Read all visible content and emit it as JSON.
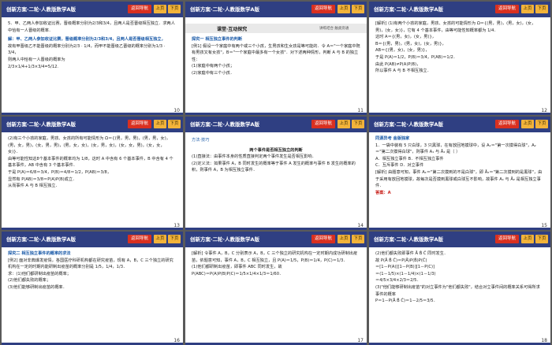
{
  "header": {
    "title": "创新方案·二轮·人教版数学A版",
    "btn_back": "返回导航",
    "btn_up": "上页",
    "btn_down": "下页"
  },
  "slides": [
    {
      "page": "10",
      "lines": [
        "5．甲、乙两人参加收证比赛，晋级概率分别为2/3和3/4，且两人是否晋级相互独立．求两人中恰有一人晋级的概率．",
        "解：甲、乙两人参加收证比赛，晋级概率分别为2/3和3/4，且两人是否晋级相互独立，",
        "故有甲晋级乙不能晋级的概率分别为2/3 · 1/4，而甲不能晋级乙晋级的概率分别为1/3 · 3/4，",
        "则两人中恰有一人晋级的概率为",
        "2/3×1/4+1/3×3/4=5/12."
      ]
    },
    {
      "page": "11",
      "band_title": "课堂·互动探究",
      "band_sub": "讲练结合  触类旁通",
      "lines": [
        "探究一    相互独立事件的判断",
        "[例1]  假设一个家庭中有两个或三个小孩，生男孩和生女孩是等可能的．令 A＝\"一个家庭中既有男孩又有女孩\"，B＝\"一个家庭中最多有一个女孩\"．对下述两种情形，判断 A 与 B 的独立性：",
        "(1)家庭中有两个小孩；",
        "(2)家庭中有三个小孩．"
      ]
    },
    {
      "page": "12",
      "lines": [
        "[解析]  (1)有两个小孩的家庭，男孩、女孩的可能情形为 Ω＝{(男，男)，(男，女)，(女，男)，(女，女)}，它有 4 个基本事件，由等可能性知概率都为 1/4．",
        "这时 A＝{(男，女)，(女，男)}，",
        "B＝{(男，男)，(男，女)，(女，男)}，",
        "AB＝{(男，女)，(女，男)}，",
        "于是 P(A)＝1/2，P(B)＝3/4，P(AB)＝1/2．",
        "由此 P(AB)≠P(A)P(B)，",
        "所以事件 A 与 B 不相互独立．"
      ]
    },
    {
      "page": "13",
      "lines": [
        "(2)有三个小孩的家庭，男孩、女孩的所有可能情形为 Ω＝{(男，男，男)，(男，男，女)，(男，女，男)，(女，男，男)，(男，女，女)，(女，男，女)，(女，女，男)，(女，女，女)}．",
        "由等可能性知这8个基本事件的概率均为 1/8，这时 A 中含有 6 个基本事件，B 中含有 4 个基本事件，AB 中含有 3 个基本事件．",
        "于是 P(A)＝6/8＝3/4，P(B)＝4/8＝1/2，P(AB)＝3/8，",
        "显然有 P(AB)＝3/8＝P(A)P(B)成立．",
        "从而事件 A 与 B 相互独立．"
      ]
    },
    {
      "page": "14",
      "lines": [
        "方法·技巧",
        "两个事件是否相互独立的判断",
        "(1)直接法：由事件本身的性质直接判定两个事件发生是否相互影响．",
        "(2)定义法：如果事件 A，B 同时发生的概率等于事件 A 发生的概率与事件 B 发生的概率的积，则事件 A，B 为相互独立事件．"
      ]
    },
    {
      "page": "15",
      "lines": [
        "同源异考  金版独家",
        "1．一袋中装有 5 只白球，3 只黑球，在有放回地摸球中，设 A₁＝\"第一次摸得白球\"，A₂＝\"第二次摸得白球\"，则事件 A₁ 与 Ā₂ 是（    ）",
        "A．相互独立事件          B．不相互独立事件",
        "C．互斥事件              D．对立事件",
        "[解析]  由题意可知，事件 A₁＝\"第二次摸到的不是白球\"，即 Ā₂＝\"第二次摸到的是黑球\"，由于采用有放回地摸球，故每次是否摸到黑球或白球互不影响，故事件 A₁ 与 Ā₂ 是相互独立事件．",
        "答案：A"
      ]
    },
    {
      "page": "16",
      "lines": [
        "探究二    相互独立事件的概率的求法",
        "[例2]  面对非典爆发疫情，各国医疗科研机构都在研究疫苗，现有 A，B，C 三个独立的研究机构在一定的时期内能研制出疫苗的概率分别是 1/5，1/4，1/3．",
        "求：(1)他们都研制出疫苗的概率；",
        "(2)他们都失败的概率；",
        "(3)他们能够研制出疫苗的概率．"
      ]
    },
    {
      "page": "17",
      "lines": [
        "[解析]  令事件 A，B，C 分别表示 A，B，C 三个独立的研究机构在一定时期内成功研制出疫苗，依题意可知，事件 A，B，C 相互独立，且 P(A)＝1/5，P(B)＝1/4，P(C)＝1/3．",
        "(1)他们都研制出疫苗，即事件 ABC 同时发生，故",
        "P(ABC)＝P(A)P(B)P(C)＝1/5×1/4×1/3＝1/60．"
      ]
    },
    {
      "page": "18",
      "lines": [
        "(2)他们都失败即事件 Ā B̄ C̄ 同时发生．",
        "故 P(Ā B̄ C̄)＝P(Ā)P(B̄)P(C̄)",
        "＝[1－P(A)][1－P(B)][1－P(C)]",
        "＝(1－1/5)×(1－1/4)×(1－1/3)",
        "＝4/5×3/4×2/3＝2/5．",
        "(3)\"他们能够研制出疫苗\"的对立事件为\"他们都失败\"，结合对立事件间的概率关系可得所求事件的概率",
        "P＝1－P(Ā B̄ C̄)＝1－2/5＝3/5．"
      ]
    }
  ]
}
